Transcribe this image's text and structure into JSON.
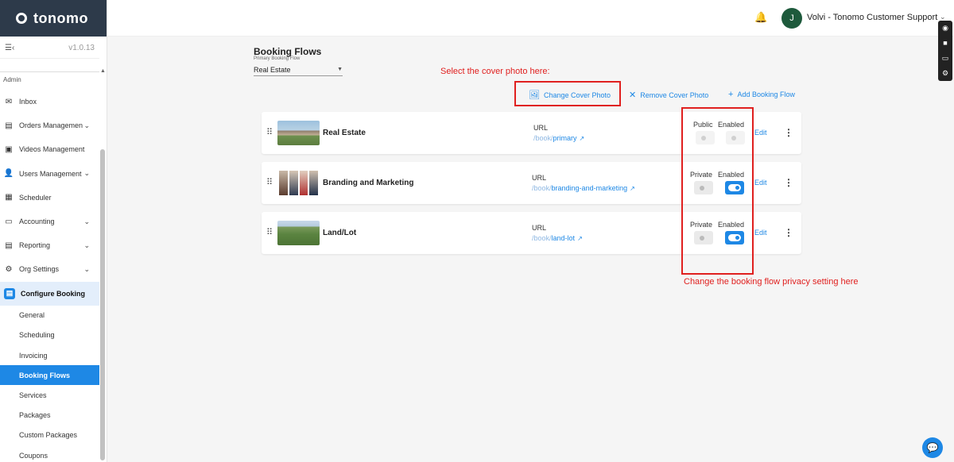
{
  "brand": {
    "name": "tonomo"
  },
  "sidebar": {
    "version": "v1.0.13",
    "section_label": "Admin",
    "items": [
      {
        "label": "Inbox",
        "icon": "envelope-icon",
        "has_chevron": false
      },
      {
        "label": "Orders Management",
        "icon": "orders-icon",
        "has_chevron": true
      },
      {
        "label": "Videos Management",
        "icon": "video-icon",
        "has_chevron": false
      },
      {
        "label": "Users Management",
        "icon": "users-icon",
        "has_chevron": true
      },
      {
        "label": "Scheduler",
        "icon": "calendar-icon",
        "has_chevron": false
      },
      {
        "label": "Accounting",
        "icon": "accounting-icon",
        "has_chevron": true
      },
      {
        "label": "Reporting",
        "icon": "report-icon",
        "has_chevron": true
      },
      {
        "label": "Org Settings",
        "icon": "gear-icon",
        "has_chevron": true
      },
      {
        "label": "Configure Booking",
        "icon": "booking-icon",
        "has_chevron": false
      }
    ],
    "sub_items": [
      "General",
      "Scheduling",
      "Invoicing",
      "Booking Flows",
      "Services",
      "Packages",
      "Custom Packages",
      "Coupons"
    ],
    "active_sub": "Booking Flows"
  },
  "topbar": {
    "avatar_initial": "J",
    "user_name": "Volvi - Tonomo Customer Support"
  },
  "page": {
    "title": "Booking Flows",
    "primary_label": "Primary Booking Flow",
    "primary_value": "Real Estate"
  },
  "toolbar": {
    "change_cover": "Change Cover Photo",
    "remove_cover": "Remove Cover Photo",
    "add_flow": "Add Booking Flow"
  },
  "annotations": {
    "cover_hint": "Select the cover photo here:",
    "privacy_hint": "Change the booking flow privacy setting here"
  },
  "flows": [
    {
      "name": "Real Estate",
      "url_label": "URL",
      "url_prefix": "/book/",
      "url_slug": "primary",
      "visibility": "Public",
      "enabled_label": "Enabled",
      "visibility_on": false,
      "enabled_on": false,
      "edit_label": "Edit"
    },
    {
      "name": "Branding and Marketing",
      "url_label": "URL",
      "url_prefix": "/book/",
      "url_slug": "branding-and-marketing",
      "visibility": "Private",
      "enabled_label": "Enabled",
      "visibility_on": false,
      "enabled_on": true,
      "edit_label": "Edit"
    },
    {
      "name": "Land/Lot",
      "url_label": "URL",
      "url_prefix": "/book/",
      "url_slug": "land-lot",
      "visibility": "Private",
      "enabled_label": "Enabled",
      "visibility_on": false,
      "enabled_on": true,
      "edit_label": "Edit"
    }
  ],
  "colors": {
    "accent": "#1e88e5",
    "annotation": "#e0201f",
    "brand_bar": "#2d3a4a"
  }
}
